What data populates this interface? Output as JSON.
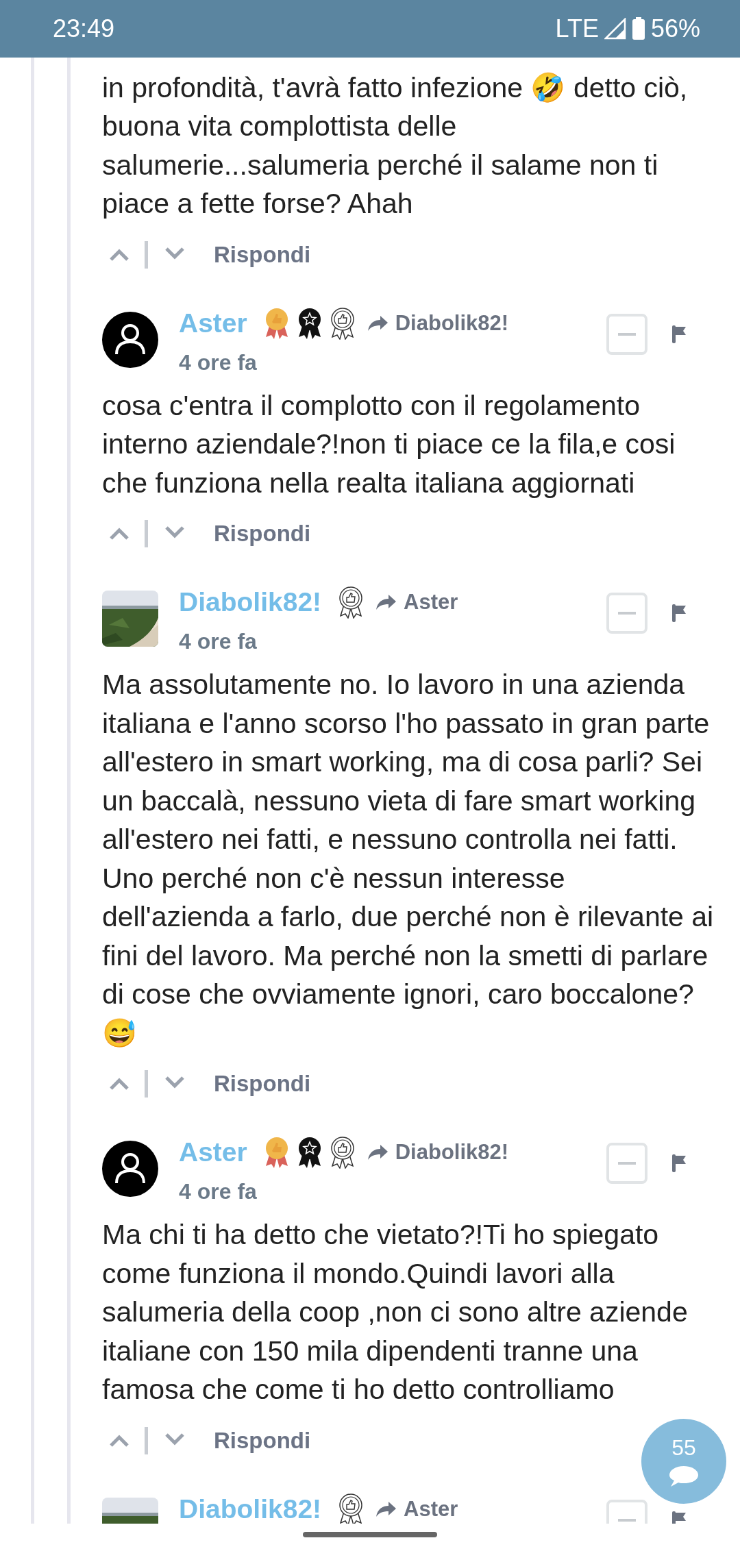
{
  "status_bar": {
    "time": "23:49",
    "network": "LTE",
    "battery": "56%"
  },
  "comments": [
    {
      "kind": "tail",
      "body": "in profondità, t'avrà fatto infezione 🤣 detto ciò, buona vita complottista delle salumerie...salumeria perché il salame non ti piace a fette forse? Ahah",
      "reply": "Rispondi"
    },
    {
      "kind": "full",
      "author": "Aster",
      "avatar": {
        "kind": "user"
      },
      "badges": [
        {
          "kind": "gold"
        },
        {
          "kind": "black"
        },
        {
          "kind": "outline"
        }
      ],
      "reply_to": "Diabolik82!",
      "time": "4 ore fa",
      "body": "cosa c'entra il complotto con il regolamento interno aziendale?!non ti piace ce la fila,e cosi che funziona nella realta italiana aggiornati",
      "reply": "Rispondi"
    },
    {
      "kind": "full",
      "author": "Diabolik82!",
      "badges": [
        {
          "kind": "outline"
        }
      ],
      "reply_to": "Aster",
      "time": "4 ore fa",
      "body": "Ma assolutamente no. Io lavoro in una azienda italiana e l'anno scorso l'ho passato in gran parte all'estero in smart working, ma di cosa parli? Sei un baccalà, nessuno vieta di fare smart working all'estero nei fatti, e nessuno controlla nei fatti. Uno perché non c'è nessun interesse dell'azienda a farlo, due perché non è rilevante ai fini del lavoro. Ma perché non la smetti di parlare di cose che ovviamente ignori, caro boccalone? 😅",
      "reply": "Rispondi"
    },
    {
      "kind": "full",
      "author": "Aster",
      "avatar": {
        "kind": "user"
      },
      "badges": [
        {
          "kind": "gold"
        },
        {
          "kind": "black"
        },
        {
          "kind": "outline"
        }
      ],
      "reply_to": "Diabolik82!",
      "time": "4 ore fa",
      "body": "Ma chi ti ha detto che vietato?!Ti ho spiegato come funziona il mondo.Quindi lavori alla salumeria della coop ,non ci sono altre aziende italiane con 150 mila dipendenti tranne una famosa che come ti ho detto controlliamo",
      "reply": "Rispondi"
    },
    {
      "kind": "header",
      "author": "Diabolik82!",
      "badges": [
        {
          "kind": "outline"
        }
      ],
      "reply_to": "Aster"
    }
  ],
  "comment_count": "55"
}
